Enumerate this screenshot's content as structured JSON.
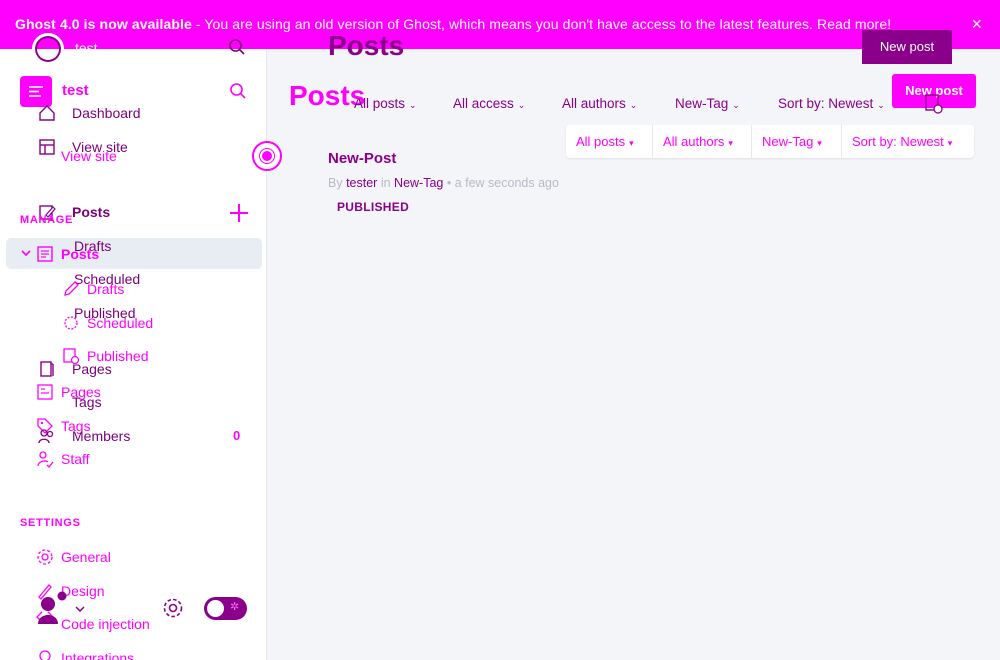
{
  "banner": {
    "bold": "Ghost 4.0 is now available",
    "text": " - You are using an old version of Ghost, which means you don't have access to the latest features. ",
    "link": "Read more!",
    "close": "×"
  },
  "site": {
    "name": "test"
  },
  "nav_overlay": {
    "dashboard": "Dashboard",
    "view_site": "View site",
    "posts": "Posts",
    "drafts": "Drafts",
    "scheduled": "Scheduled",
    "published": "Published",
    "pages": "Pages",
    "tags": "Tags",
    "members": "Members",
    "members_count": "0"
  },
  "nav": {
    "view_site": "View site",
    "manage_header": "MANAGE",
    "posts": "Posts",
    "drafts": "Drafts",
    "scheduled": "Scheduled",
    "published": "Published",
    "pages": "Pages",
    "tags": "Tags",
    "staff": "Staff",
    "settings_header": "SETTINGS",
    "general": "General",
    "design": "Design",
    "code_injection": "Code injection",
    "integrations": "Integrations"
  },
  "main": {
    "title_back": "Posts",
    "title_front": "Posts",
    "new_post_back": "New post",
    "new_post_front": "New post",
    "filters_back": [
      "All posts",
      "All access",
      "All authors",
      "New-Tag",
      "Sort by: Newest"
    ],
    "filters_front": [
      "All posts",
      "All authors",
      "New-Tag",
      "Sort by: Newest"
    ]
  },
  "posts": [
    {
      "title": "New-Post",
      "by": "By",
      "author": "tester",
      "in": "in",
      "tag": "New-Tag",
      "time": "• a few seconds ago",
      "status": "PUBLISHED"
    }
  ],
  "colors": {
    "accent": "#ff00ff",
    "dark_accent": "#8a008a",
    "sidebar_active": "#e8ecf3"
  },
  "icons": [
    "search-icon",
    "home-icon",
    "view-site-icon",
    "posts-icon",
    "plus-icon",
    "pencil-icon",
    "clock-icon",
    "check-doc-icon",
    "pages-icon",
    "tag-icon",
    "members-icon",
    "staff-icon",
    "gear-icon",
    "brush-icon",
    "code-icon",
    "integrations-icon",
    "avatar-icon",
    "toggle-switch"
  ]
}
